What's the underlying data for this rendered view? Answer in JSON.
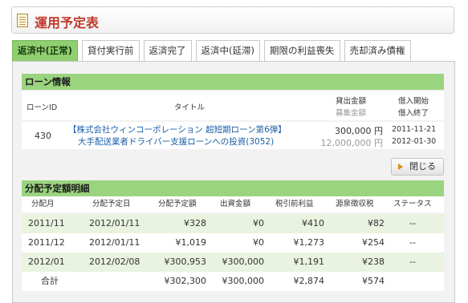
{
  "header": {
    "title": "運用予定表",
    "icon": "document-icon"
  },
  "tabs": [
    {
      "label": "返済中(正常)",
      "active": true
    },
    {
      "label": "貸付実行前",
      "active": false
    },
    {
      "label": "返済完了",
      "active": false
    },
    {
      "label": "返済中(延滞)",
      "active": false
    },
    {
      "label": "期限の利益喪失",
      "active": false
    },
    {
      "label": "売却済み債権",
      "active": false
    }
  ],
  "loan_info": {
    "heading": "ローン情報",
    "col_id": "ローンID",
    "col_title": "タイトル",
    "col_amount_top": "貸出金額",
    "col_amount_bottom": "募集金額",
    "col_date_top": "借入開始",
    "col_date_bottom": "借入終了",
    "id": "430",
    "title_line1": "【株式会社ウィンコーポレーション 超短期ローン第6弾】",
    "title_line2": "大手配送業者ドライバー支援ローンへの投資(3052)",
    "loan_amount": "300,000 円",
    "offer_amount": "12,000,000 円",
    "start_date": "2011-11-21",
    "end_date": "2012-01-30"
  },
  "close_button": {
    "label": "閉じる",
    "icon": "play-arrow-icon"
  },
  "schedule": {
    "heading": "分配予定額明細",
    "columns": [
      "分配月",
      "分配予定日",
      "分配予定額",
      "出資金額",
      "税引前利益",
      "源泉徴収税",
      "ステータス"
    ],
    "rows": [
      {
        "month": "2011/11",
        "date": "2012/01/11",
        "dist": "¥328",
        "capital": "¥0",
        "profit": "¥410",
        "tax": "¥82",
        "status": "--"
      },
      {
        "month": "2011/12",
        "date": "2012/01/11",
        "dist": "¥1,019",
        "capital": "¥0",
        "profit": "¥1,273",
        "tax": "¥254",
        "status": "--"
      },
      {
        "month": "2012/01",
        "date": "2012/02/08",
        "dist": "¥300,953",
        "capital": "¥300,000",
        "profit": "¥1,191",
        "tax": "¥238",
        "status": "--"
      }
    ],
    "total": {
      "label": "合計",
      "dist": "¥302,300",
      "capital": "¥300,000",
      "profit": "¥2,874",
      "tax": "¥574"
    }
  }
}
